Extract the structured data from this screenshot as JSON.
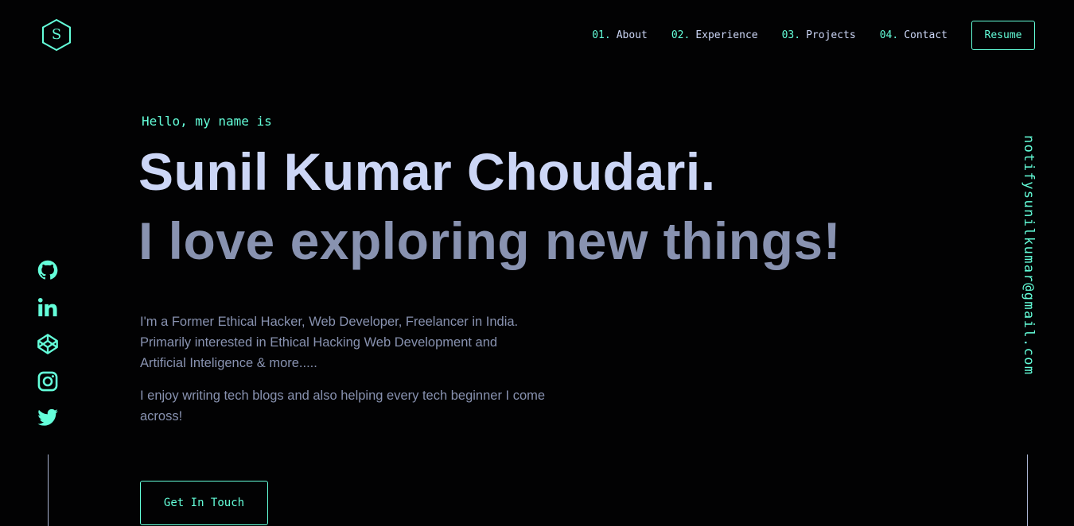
{
  "logo": {
    "letter": "S"
  },
  "nav": {
    "items": [
      {
        "num": "01.",
        "label": "About"
      },
      {
        "num": "02.",
        "label": "Experience"
      },
      {
        "num": "03.",
        "label": "Projects"
      },
      {
        "num": "04.",
        "label": "Contact"
      }
    ],
    "resume_label": "Resume"
  },
  "hero": {
    "greeting": "Hello, my name is",
    "name": "Sunil Kumar Choudari.",
    "tagline": "I love exploring new things!",
    "para1": "I'm a Former Ethical Hacker, Web Developer, Freelancer in India. Primarily interested in Ethical Hacking Web Development and Artificial Inteligence & more.....",
    "para2": "I enjoy writing tech blogs and also helping every tech beginner I come across!",
    "cta_label": "Get In Touch"
  },
  "socials": [
    {
      "icon": "github-icon"
    },
    {
      "icon": "linkedin-icon"
    },
    {
      "icon": "codepen-icon"
    },
    {
      "icon": "instagram-icon"
    },
    {
      "icon": "twitter-icon"
    }
  ],
  "email": "notifysunilkumar@gmail.com",
  "colors": {
    "background": "#020203",
    "accent": "#64ffda",
    "heading": "#ccd6f6",
    "body": "#8892b0"
  }
}
